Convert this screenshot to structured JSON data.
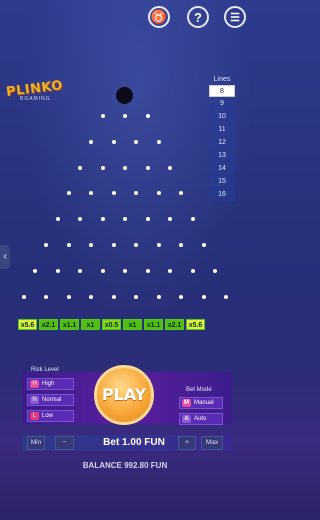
{
  "header": {
    "zodiac_icon": "taurus-icon",
    "help_label": "?",
    "menu_label": "☰"
  },
  "logo": {
    "title": "PLINKO",
    "subtitle": "BGAMING"
  },
  "lines": {
    "title": "Lines",
    "options": [
      "8",
      "9",
      "10",
      "11",
      "12",
      "13",
      "14",
      "15",
      "16"
    ],
    "selected": "8"
  },
  "multipliers": [
    "x5.6",
    "x2.1",
    "x1.1",
    "x1",
    "x0.5",
    "x1",
    "x1.1",
    "x2.1",
    "x5.6"
  ],
  "risk": {
    "title": "Risk Level",
    "options": [
      {
        "label": "High",
        "icon": "H"
      },
      {
        "label": "Normal",
        "icon": "N"
      },
      {
        "label": "Low",
        "icon": "L"
      }
    ],
    "selected": "Low"
  },
  "play_label": "PLAY",
  "mode": {
    "title": "Bet Mode",
    "options": [
      {
        "label": "Manual",
        "icon": "M"
      },
      {
        "label": "Auto",
        "icon": "A"
      }
    ],
    "selected": "Manual"
  },
  "bet": {
    "min_label": "Min",
    "minus_label": "−",
    "text": "Bet 1.00 FUN",
    "plus_label": "+",
    "max_label": "Max"
  },
  "balance": "BALANCE 992.80 FUN",
  "colors": {
    "multiplier_green": "#4fbf14",
    "multiplier_light": "#d9f23a",
    "play_orange": "#f7a83a",
    "panel_purple": "#5a1fa0",
    "risk_high": "#e84b9a",
    "risk_normal": "#8a5bd6",
    "risk_low": "#e23a7a",
    "mode_manual": "#e84b9a",
    "mode_auto": "#8a5bd6"
  }
}
